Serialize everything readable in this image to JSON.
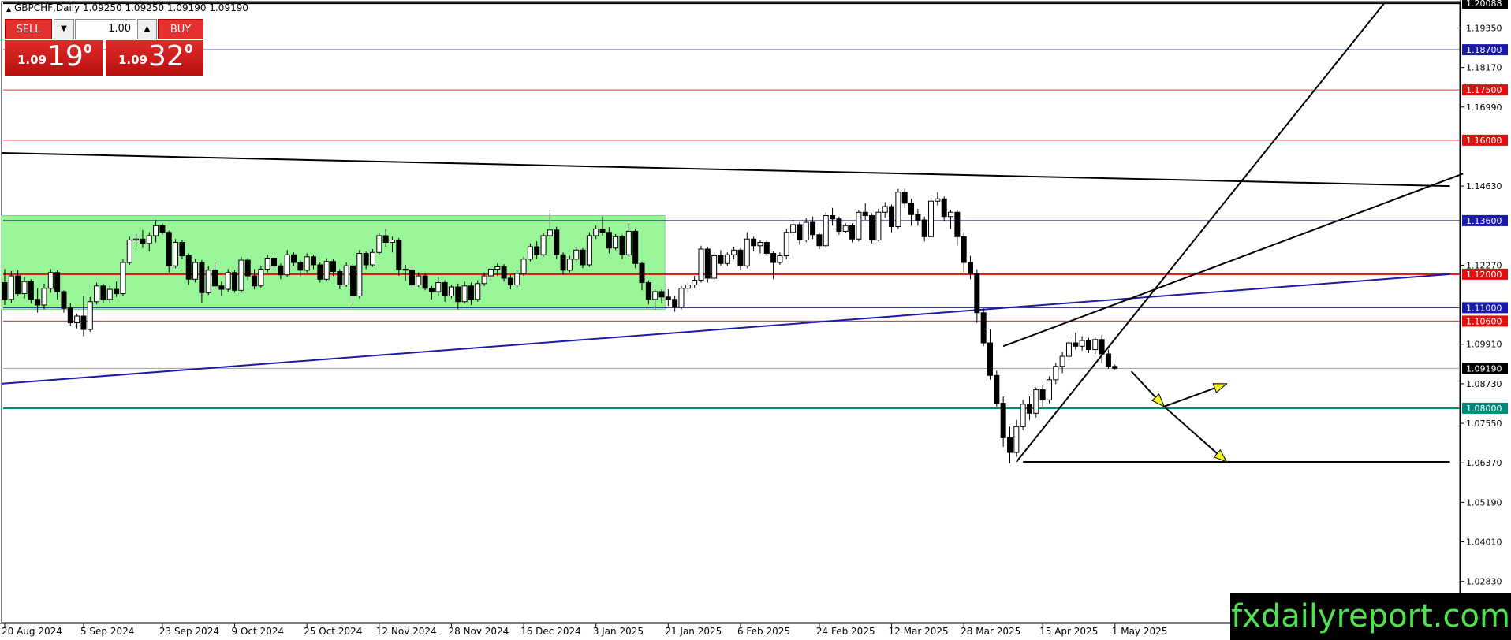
{
  "window": {
    "symbol_title": "GBPCHF,Daily  1.09250 1.09250 1.09190 1.09190"
  },
  "trade_panel": {
    "sell_label": "SELL",
    "buy_label": "BUY",
    "lot_value": "1.00",
    "sell_price_prefix": "1.09",
    "sell_price_big": "19",
    "sell_price_sup": "0",
    "buy_price_prefix": "1.09",
    "buy_price_big": "32",
    "buy_price_sup": "0"
  },
  "watermark": "fxdailyreport.com",
  "chart_data": {
    "type": "candlestick",
    "symbol": "GBPCHF",
    "timeframe": "Daily",
    "y_range": [
      1.016,
      1.2009
    ],
    "price_scale_labels": [
      "1.19350",
      "1.18170",
      "1.16990",
      "1.14630",
      "1.12270",
      "1.09910",
      "1.08730",
      "1.07550",
      "1.06370",
      "1.05190",
      "1.04010",
      "1.02830"
    ],
    "x_labels": [
      "20 Aug 2024",
      "5 Sep 2024",
      "23 Sep 2024",
      "9 Oct 2024",
      "25 Oct 2024",
      "12 Nov 2024",
      "28 Nov 2024",
      "16 Dec 2024",
      "3 Jan 2025",
      "21 Jan 2025",
      "6 Feb 2025",
      "24 Feb 2025",
      "12 Mar 2025",
      "28 Mar 2025",
      "15 Apr 2025",
      "1 May 2025"
    ],
    "x_label_bar_index": [
      0,
      12,
      24,
      35,
      46,
      57,
      68,
      79,
      90,
      101,
      112,
      124,
      135,
      146,
      158,
      169
    ],
    "current_price": "1.09190",
    "horizontal_levels": [
      {
        "price": 1.20088,
        "label": "1.20088",
        "color": "#000000",
        "label_bg": "#000000"
      },
      {
        "price": 1.187,
        "label": "1.18700",
        "color": "#1a237e",
        "label_bg": "#1a1aa8"
      },
      {
        "price": 1.175,
        "label": "1.17500",
        "color": "#d32f2f",
        "label_bg": "#e01010"
      },
      {
        "price": 1.16,
        "label": "1.16000",
        "color": "#d32f2f",
        "label_bg": "#e01010"
      },
      {
        "price": 1.136,
        "label": "1.13600",
        "color": "#1a237e",
        "label_bg": "#1a1aa8"
      },
      {
        "price": 1.12,
        "label": "1.12000",
        "color": "#e01010",
        "label_bg": "#e01010"
      },
      {
        "price": 1.11,
        "label": "1.11000",
        "color": "#1a237e",
        "label_bg": "#1a1aa8"
      },
      {
        "price": 1.106,
        "label": "1.10600",
        "color": "#d32f2f",
        "label_bg": "#e01010"
      },
      {
        "price": 1.0919,
        "label": "1.09190",
        "color": "#9e9e9e",
        "label_bg": "#000000"
      },
      {
        "price": 1.08,
        "label": "1.08000",
        "color": "#00897b",
        "label_bg": "#00897b"
      }
    ],
    "range_box": {
      "bar_start": -0.5,
      "bar_end": 100.5,
      "top": 1.1375,
      "bottom": 1.1095,
      "color": "#98f598"
    },
    "trendlines": [
      {
        "b1": -0.5,
        "p1": 1.1562,
        "b2": 220,
        "p2": 1.1463,
        "color": "#000000",
        "width": 2
      },
      {
        "b1": -0.5,
        "p1": 1.0873,
        "b2": 220,
        "p2": 1.12,
        "color": "#1a1aa8",
        "width": 2
      },
      {
        "b1": 154,
        "p1": 1.064,
        "b2": 210,
        "p2": 1.2009,
        "color": "#000000",
        "width": 2
      },
      {
        "b1": 152,
        "p1": 1.0985,
        "b2": 222,
        "p2": 1.15,
        "color": "#000000",
        "width": 2
      },
      {
        "b1": 155,
        "p1": 1.064,
        "b2": 220,
        "p2": 1.064,
        "color": "#000000",
        "width": 2
      }
    ],
    "arrows": [
      {
        "b1": 171.5,
        "p1": 1.091,
        "b2": 176.5,
        "p2": 1.0805
      },
      {
        "b1": 176.5,
        "p1": 1.0805,
        "b2": 186,
        "p2": 1.0873
      },
      {
        "b1": 176.5,
        "p1": 1.0805,
        "b2": 186,
        "p2": 1.064
      }
    ],
    "candles": [
      [
        1.1175,
        1.1215,
        1.1108,
        1.1125
      ],
      [
        1.1125,
        1.121,
        1.1115,
        1.1195
      ],
      [
        1.1195,
        1.1212,
        1.1135,
        1.1142
      ],
      [
        1.1142,
        1.1192,
        1.1128,
        1.1178
      ],
      [
        1.1178,
        1.1185,
        1.1112,
        1.1125
      ],
      [
        1.1125,
        1.1158,
        1.1085,
        1.1108
      ],
      [
        1.1108,
        1.1172,
        1.1095,
        1.1158
      ],
      [
        1.1158,
        1.1215,
        1.1145,
        1.1205
      ],
      [
        1.1205,
        1.1212,
        1.1125,
        1.1148
      ],
      [
        1.1148,
        1.1152,
        1.1085,
        1.1098
      ],
      [
        1.1098,
        1.1115,
        1.1045,
        1.1055
      ],
      [
        1.1055,
        1.1082,
        1.1038,
        1.1075
      ],
      [
        1.1075,
        1.1135,
        1.1015,
        1.1035
      ],
      [
        1.1035,
        1.1132,
        1.1028,
        1.1118
      ],
      [
        1.1118,
        1.1175,
        1.111,
        1.1165
      ],
      [
        1.1165,
        1.1172,
        1.1115,
        1.1125
      ],
      [
        1.1125,
        1.1165,
        1.1115,
        1.1155
      ],
      [
        1.1155,
        1.1178,
        1.1132,
        1.1142
      ],
      [
        1.1142,
        1.1245,
        1.1135,
        1.1235
      ],
      [
        1.1235,
        1.1312,
        1.1228,
        1.1302
      ],
      [
        1.1302,
        1.1322,
        1.1282,
        1.1305
      ],
      [
        1.1305,
        1.1332,
        1.1278,
        1.1292
      ],
      [
        1.1292,
        1.1325,
        1.1268,
        1.1315
      ],
      [
        1.1315,
        1.1362,
        1.1295,
        1.1345
      ],
      [
        1.1345,
        1.1352,
        1.1318,
        1.1325
      ],
      [
        1.1325,
        1.133,
        1.1205,
        1.1225
      ],
      [
        1.1225,
        1.1305,
        1.1218,
        1.1295
      ],
      [
        1.1295,
        1.1302,
        1.1245,
        1.1255
      ],
      [
        1.1255,
        1.1262,
        1.1168,
        1.1185
      ],
      [
        1.1185,
        1.1245,
        1.1175,
        1.1235
      ],
      [
        1.1235,
        1.1242,
        1.1115,
        1.1145
      ],
      [
        1.1145,
        1.1225,
        1.1138,
        1.1212
      ],
      [
        1.1212,
        1.1235,
        1.1155,
        1.1165
      ],
      [
        1.1165,
        1.1178,
        1.1135,
        1.1155
      ],
      [
        1.1155,
        1.1215,
        1.1148,
        1.1205
      ],
      [
        1.1205,
        1.1212,
        1.1145,
        1.1152
      ],
      [
        1.1152,
        1.1252,
        1.1145,
        1.1242
      ],
      [
        1.1242,
        1.1248,
        1.1182,
        1.1195
      ],
      [
        1.1195,
        1.1215,
        1.1155,
        1.1165
      ],
      [
        1.1165,
        1.1225,
        1.1158,
        1.1215
      ],
      [
        1.1215,
        1.1258,
        1.1205,
        1.1248
      ],
      [
        1.1248,
        1.1262,
        1.1215,
        1.1225
      ],
      [
        1.1225,
        1.1232,
        1.1185,
        1.1198
      ],
      [
        1.1198,
        1.1272,
        1.1192,
        1.1258
      ],
      [
        1.1258,
        1.1265,
        1.1225,
        1.1235
      ],
      [
        1.1235,
        1.1242,
        1.1195,
        1.1212
      ],
      [
        1.1212,
        1.1262,
        1.1205,
        1.1252
      ],
      [
        1.1252,
        1.1258,
        1.1215,
        1.1228
      ],
      [
        1.1228,
        1.1235,
        1.1175,
        1.1185
      ],
      [
        1.1185,
        1.1248,
        1.1178,
        1.1238
      ],
      [
        1.1238,
        1.1245,
        1.1195,
        1.1208
      ],
      [
        1.1208,
        1.1215,
        1.1155,
        1.1168
      ],
      [
        1.1168,
        1.1235,
        1.1162,
        1.1225
      ],
      [
        1.1225,
        1.123,
        1.1108,
        1.1135
      ],
      [
        1.1135,
        1.1272,
        1.1128,
        1.1262
      ],
      [
        1.1262,
        1.1268,
        1.1215,
        1.1228
      ],
      [
        1.1228,
        1.1275,
        1.1222,
        1.1265
      ],
      [
        1.1265,
        1.1322,
        1.1258,
        1.1315
      ],
      [
        1.1315,
        1.1335,
        1.1282,
        1.1295
      ],
      [
        1.1295,
        1.1312,
        1.1265,
        1.1302
      ],
      [
        1.1302,
        1.1308,
        1.1195,
        1.1215
      ],
      [
        1.1215,
        1.1228,
        1.118,
        1.1212
      ],
      [
        1.1212,
        1.1222,
        1.1158,
        1.1168
      ],
      [
        1.1168,
        1.1205,
        1.1162,
        1.1195
      ],
      [
        1.1195,
        1.1202,
        1.1152,
        1.1158
      ],
      [
        1.1158,
        1.1165,
        1.1125,
        1.1148
      ],
      [
        1.1148,
        1.1192,
        1.1135,
        1.1175
      ],
      [
        1.1175,
        1.1182,
        1.1118,
        1.1135
      ],
      [
        1.1135,
        1.1168,
        1.1128,
        1.1162
      ],
      [
        1.1162,
        1.1172,
        1.1095,
        1.1118
      ],
      [
        1.1118,
        1.1178,
        1.1112,
        1.1165
      ],
      [
        1.1165,
        1.1175,
        1.1108,
        1.1125
      ],
      [
        1.1125,
        1.1182,
        1.1118,
        1.1172
      ],
      [
        1.1172,
        1.1205,
        1.1165,
        1.1195
      ],
      [
        1.1195,
        1.1225,
        1.1182,
        1.1215
      ],
      [
        1.1215,
        1.1232,
        1.1195,
        1.1222
      ],
      [
        1.1222,
        1.123,
        1.1178,
        1.1188
      ],
      [
        1.1188,
        1.1198,
        1.1155,
        1.1168
      ],
      [
        1.1168,
        1.1212,
        1.1162,
        1.1202
      ],
      [
        1.1202,
        1.1252,
        1.1195,
        1.1245
      ],
      [
        1.1245,
        1.1292,
        1.1238,
        1.1282
      ],
      [
        1.1282,
        1.1298,
        1.1245,
        1.1258
      ],
      [
        1.1258,
        1.1322,
        1.1252,
        1.1315
      ],
      [
        1.1315,
        1.1392,
        1.1305,
        1.1332
      ],
      [
        1.1332,
        1.1342,
        1.1245,
        1.1258
      ],
      [
        1.1258,
        1.1265,
        1.1198,
        1.1212
      ],
      [
        1.1212,
        1.1255,
        1.1205,
        1.1245
      ],
      [
        1.1245,
        1.1282,
        1.1235,
        1.1272
      ],
      [
        1.1272,
        1.1278,
        1.1218,
        1.1228
      ],
      [
        1.1228,
        1.1325,
        1.1222,
        1.1315
      ],
      [
        1.1315,
        1.1345,
        1.1305,
        1.1335
      ],
      [
        1.1335,
        1.1372,
        1.1315,
        1.1325
      ],
      [
        1.1325,
        1.134,
        1.1262,
        1.1278
      ],
      [
        1.1278,
        1.132,
        1.1272,
        1.1312
      ],
      [
        1.1312,
        1.1318,
        1.1245,
        1.1258
      ],
      [
        1.1258,
        1.1352,
        1.1252,
        1.1328
      ],
      [
        1.1328,
        1.1335,
        1.1218,
        1.1232
      ],
      [
        1.1232,
        1.1238,
        1.1152,
        1.1175
      ],
      [
        1.1175,
        1.1182,
        1.111,
        1.1125
      ],
      [
        1.1125,
        1.1155,
        1.1095,
        1.1148
      ],
      [
        1.1148,
        1.1155,
        1.1112,
        1.1132
      ],
      [
        1.1132,
        1.1155,
        1.1105,
        1.1125
      ],
      [
        1.1125,
        1.1135,
        1.1088,
        1.1102
      ],
      [
        1.1102,
        1.1165,
        1.1095,
        1.1158
      ],
      [
        1.1158,
        1.1175,
        1.1145,
        1.1168
      ],
      [
        1.1168,
        1.1195,
        1.1158,
        1.1182
      ],
      [
        1.1182,
        1.1285,
        1.1175,
        1.1275
      ],
      [
        1.1275,
        1.1282,
        1.1175,
        1.1188
      ],
      [
        1.1188,
        1.1265,
        1.1182,
        1.1255
      ],
      [
        1.1255,
        1.1272,
        1.1225,
        1.1232
      ],
      [
        1.1232,
        1.1265,
        1.1225,
        1.1258
      ],
      [
        1.1258,
        1.1282,
        1.1245,
        1.1272
      ],
      [
        1.1272,
        1.1278,
        1.1212,
        1.1225
      ],
      [
        1.1225,
        1.1325,
        1.1218,
        1.1305
      ],
      [
        1.1305,
        1.1312,
        1.1268,
        1.1285
      ],
      [
        1.1285,
        1.1302,
        1.1262,
        1.1295
      ],
      [
        1.1295,
        1.1302,
        1.1255,
        1.1262
      ],
      [
        1.1262,
        1.1268,
        1.1185,
        1.1235
      ],
      [
        1.1235,
        1.1265,
        1.1228,
        1.1255
      ],
      [
        1.1255,
        1.1335,
        1.1245,
        1.1325
      ],
      [
        1.1325,
        1.1362,
        1.1315,
        1.1348
      ],
      [
        1.1348,
        1.1355,
        1.1288,
        1.1302
      ],
      [
        1.1302,
        1.1368,
        1.1295,
        1.1355
      ],
      [
        1.1355,
        1.1372,
        1.1305,
        1.1318
      ],
      [
        1.1318,
        1.1325,
        1.1275,
        1.1285
      ],
      [
        1.1285,
        1.1385,
        1.1278,
        1.1375
      ],
      [
        1.1375,
        1.1398,
        1.1345,
        1.1365
      ],
      [
        1.1365,
        1.1372,
        1.1318,
        1.1328
      ],
      [
        1.1328,
        1.1352,
        1.1322,
        1.1345
      ],
      [
        1.1345,
        1.1352,
        1.1295,
        1.1305
      ],
      [
        1.1305,
        1.1392,
        1.1298,
        1.1385
      ],
      [
        1.1385,
        1.1412,
        1.1362,
        1.1375
      ],
      [
        1.1375,
        1.1382,
        1.1292,
        1.1302
      ],
      [
        1.1302,
        1.1395,
        1.1298,
        1.1385
      ],
      [
        1.1385,
        1.1415,
        1.1368,
        1.1402
      ],
      [
        1.1402,
        1.1408,
        1.1325,
        1.1342
      ],
      [
        1.1342,
        1.1455,
        1.1335,
        1.1445
      ],
      [
        1.1445,
        1.1455,
        1.1398,
        1.1412
      ],
      [
        1.1412,
        1.1425,
        1.1345,
        1.1378
      ],
      [
        1.1378,
        1.1395,
        1.1345,
        1.1362
      ],
      [
        1.1362,
        1.1372,
        1.1298,
        1.1312
      ],
      [
        1.1312,
        1.1428,
        1.1305,
        1.1418
      ],
      [
        1.1418,
        1.1445,
        1.1405,
        1.1425
      ],
      [
        1.1425,
        1.1432,
        1.1358,
        1.1372
      ],
      [
        1.1372,
        1.1392,
        1.1335,
        1.1385
      ],
      [
        1.1385,
        1.1392,
        1.1285,
        1.1312
      ],
      [
        1.1312,
        1.1325,
        1.1205,
        1.1235
      ],
      [
        1.1235,
        1.1255,
        1.1185,
        1.1202
      ],
      [
        1.1202,
        1.1215,
        1.1055,
        1.1085
      ],
      [
        1.1085,
        1.1098,
        1.0985,
        1.0995
      ],
      [
        1.0995,
        1.1035,
        1.0885,
        1.0898
      ],
      [
        1.0898,
        1.0912,
        1.0805,
        1.0815
      ],
      [
        1.0815,
        1.0835,
        1.0685,
        1.0712
      ],
      [
        1.0712,
        1.0745,
        1.0635,
        1.0668
      ],
      [
        1.0668,
        1.0765,
        1.0655,
        1.0745
      ],
      [
        1.0745,
        1.0825,
        1.0735,
        1.0812
      ],
      [
        1.0812,
        1.0835,
        1.0765,
        1.0785
      ],
      [
        1.0785,
        1.0862,
        1.0772,
        1.0855
      ],
      [
        1.0855,
        1.0868,
        1.0805,
        1.0825
      ],
      [
        1.0825,
        1.0895,
        1.0815,
        1.0885
      ],
      [
        1.0885,
        1.0935,
        1.0872,
        1.0925
      ],
      [
        1.0925,
        1.0968,
        1.0905,
        1.0955
      ],
      [
        1.0955,
        1.1005,
        1.0945,
        1.0995
      ],
      [
        1.0995,
        1.1025,
        1.0975,
        1.0985
      ],
      [
        1.0985,
        1.1015,
        1.0972,
        1.1002
      ],
      [
        1.1002,
        1.101,
        1.0965,
        1.0975
      ],
      [
        1.0975,
        1.1012,
        1.0962,
        1.1005
      ],
      [
        1.1005,
        1.1018,
        1.0935,
        1.0962
      ],
      [
        1.0962,
        1.0975,
        1.0918,
        1.0925
      ],
      [
        1.0925,
        1.093,
        1.0915,
        1.0919
      ]
    ]
  }
}
